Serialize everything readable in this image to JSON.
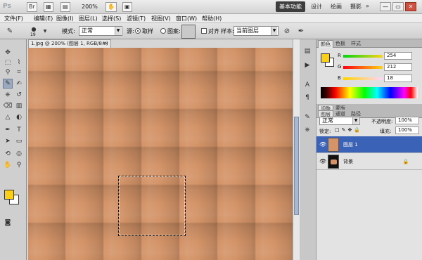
{
  "titlebar": {
    "logo": "Ps",
    "zoom": "200%",
    "workspaces": [
      "基本功能",
      "设计",
      "绘画",
      "摄影"
    ],
    "active_workspace": "基本功能",
    "more": "»",
    "minimize": "—",
    "restore": "▭",
    "close": "✕"
  },
  "menubar": {
    "items": [
      "文件(F)",
      "编辑(E)",
      "图像(I)",
      "图层(L)",
      "选择(S)",
      "滤镜(T)",
      "视图(V)",
      "窗口(W)",
      "帮助(H)"
    ]
  },
  "options": {
    "brush_size": "19",
    "mode_label": "模式:",
    "mode_value": "正常",
    "source_label": "源:",
    "source_sampled": "取样",
    "source_pattern": "图案:",
    "aligned_label": "对齐",
    "sample_label": "样本:",
    "sample_value": "当前图层"
  },
  "document": {
    "tab_title": "1.jpg @ 200% (图层 1, RGB/8#)",
    "close": "×"
  },
  "colors": {
    "foreground": "#fcd012",
    "background": "#ffffff",
    "canvas": "#d49468",
    "selected_layer": "#3a62b7"
  },
  "color_panel": {
    "tabs": [
      "颜色",
      "色板",
      "样式"
    ],
    "channels": [
      {
        "label": "R",
        "value": "254"
      },
      {
        "label": "G",
        "value": "212"
      },
      {
        "label": "B",
        "value": "18"
      }
    ]
  },
  "mid_tabs": [
    "调整",
    "蒙版"
  ],
  "layers_panel": {
    "tabs": [
      "图层",
      "通道",
      "路径"
    ],
    "blend_mode": "正常",
    "opacity_label": "不透明度:",
    "opacity_value": "100%",
    "lock_label": "锁定:",
    "fill_label": "填充:",
    "fill_value": "100%",
    "layers": [
      {
        "name": "图层 1"
      },
      {
        "name": "背景"
      }
    ]
  }
}
